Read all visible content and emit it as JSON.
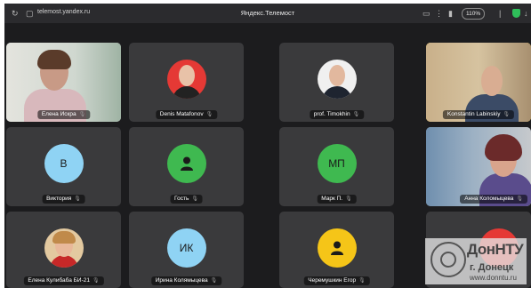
{
  "browser": {
    "url": "telemost.yandex.ru",
    "title": "Яндекс.Телемост",
    "zoom": "110%"
  },
  "participants": [
    {
      "name": "Елена Искра",
      "kind": "video"
    },
    {
      "name": "Denis Matafonov",
      "kind": "photo"
    },
    {
      "name": "prof. Timokhin",
      "kind": "photo"
    },
    {
      "name": "Konstantin Labinskiy",
      "kind": "video",
      "active": true
    },
    {
      "name": "Виктория",
      "kind": "initials",
      "initials": "В",
      "color": "#8fd3f4"
    },
    {
      "name": "Гость",
      "kind": "icon",
      "color": "#3fb950"
    },
    {
      "name": "Марк П.",
      "kind": "initials",
      "initials": "МП",
      "color": "#3fb950"
    },
    {
      "name": "Анна Коломыцева",
      "kind": "video"
    },
    {
      "name": "Елена Кулибаба БИ-21",
      "kind": "photo"
    },
    {
      "name": "Ирина Колямыцева",
      "kind": "initials",
      "initials": "ИК",
      "color": "#8fd3f4"
    },
    {
      "name": "Черемушкин Егор",
      "kind": "icon",
      "color": "#f5c518"
    },
    {
      "name": "",
      "kind": "icon",
      "color": "#e53935"
    }
  ],
  "watermark": {
    "line1": "ДонНТУ",
    "line2": "г. Донецк",
    "line3": "www.donntu.ru"
  }
}
